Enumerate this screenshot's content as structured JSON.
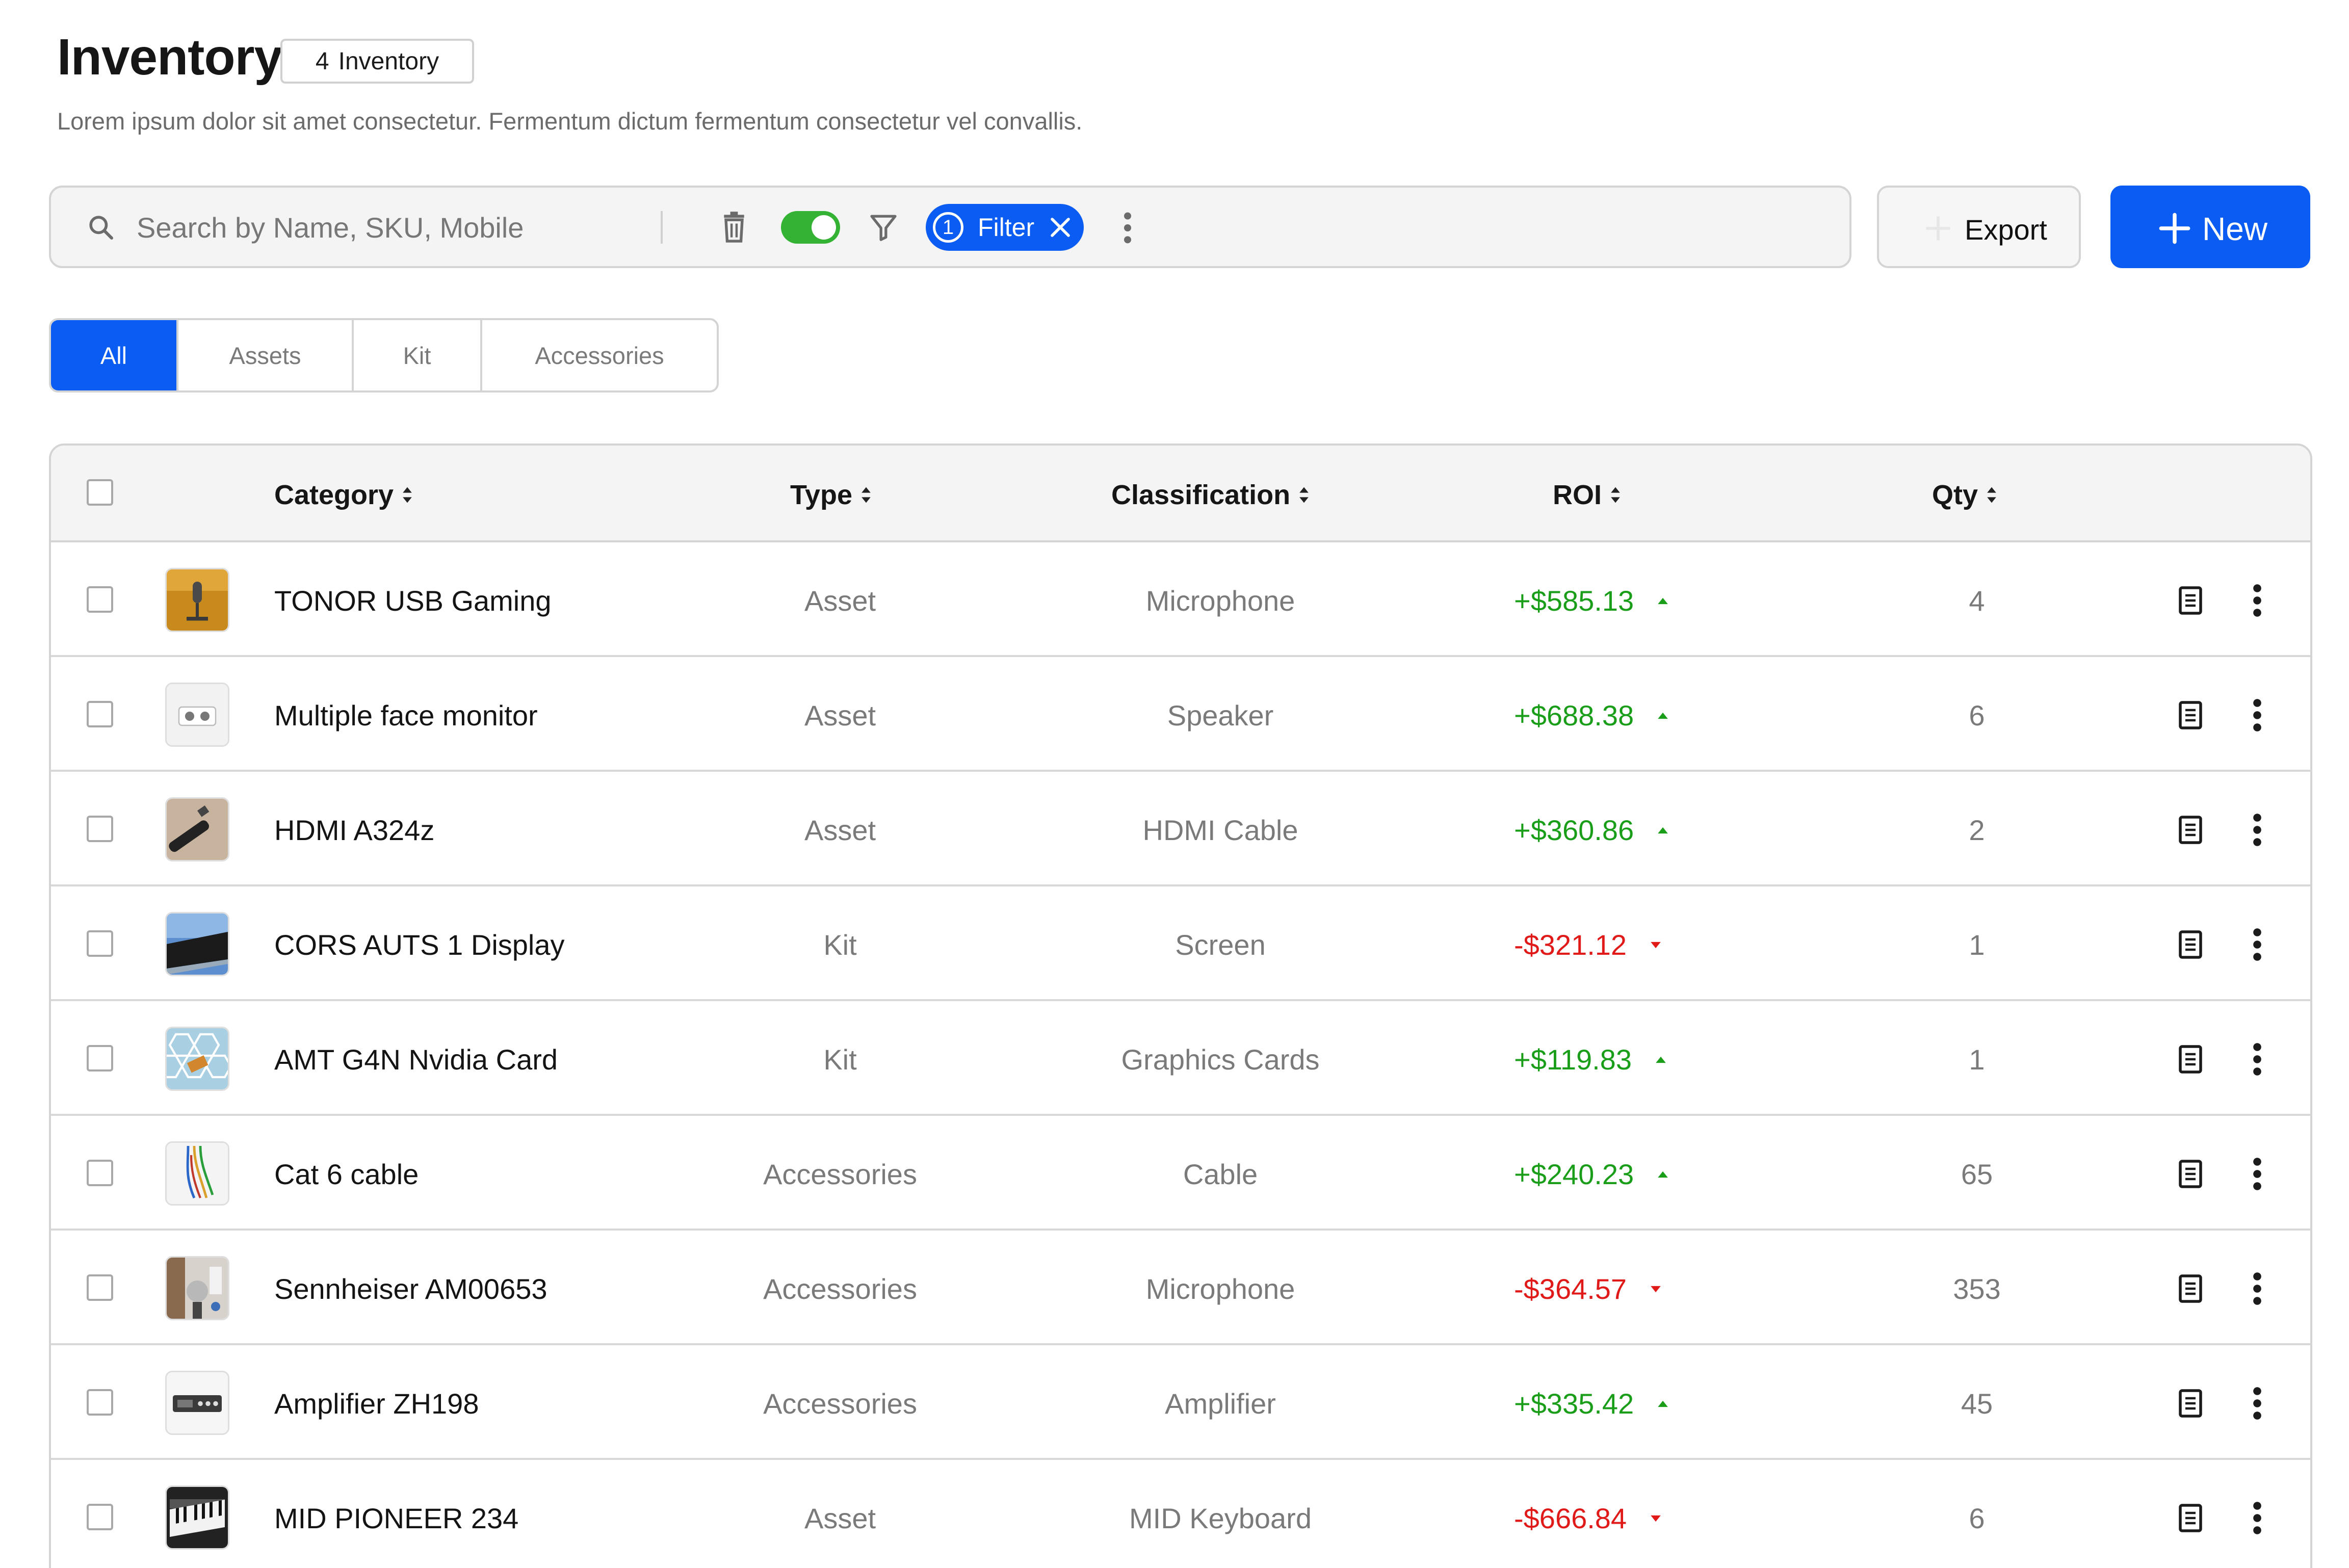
{
  "header": {
    "title": "Inventory",
    "badge": {
      "count": "4",
      "label": "Inventory"
    },
    "subtitle": "Lorem ipsum dolor sit amet consectetur. Fermentum dictum fermentum consectetur vel convallis."
  },
  "toolbar": {
    "search_placeholder": "Search by Name, SKU, Mobile",
    "toggle_on": true,
    "filter": {
      "count": "1",
      "label": "Filter"
    }
  },
  "actions": {
    "export_label": "Export",
    "new_label": "New"
  },
  "tabs": [
    {
      "label": "All",
      "active": true
    },
    {
      "label": "Assets",
      "active": false
    },
    {
      "label": "Kit",
      "active": false
    },
    {
      "label": "Accessories",
      "active": false
    }
  ],
  "table": {
    "headers": {
      "category": "Category",
      "type": "Type",
      "classification": "Classification",
      "roi": "ROI",
      "qty": "Qty"
    },
    "rows": [
      {
        "name": "TONOR USB Gaming",
        "type": "Asset",
        "classification": "Microphone",
        "roi": "+$585.13",
        "trend": "up",
        "qty": "4",
        "thumb": "microphone"
      },
      {
        "name": "Multiple face monitor",
        "type": "Asset",
        "classification": "Speaker",
        "roi": "+$688.38",
        "trend": "up",
        "qty": "6",
        "thumb": "speaker"
      },
      {
        "name": "HDMI A324z",
        "type": "Asset",
        "classification": "HDMI Cable",
        "roi": "+$360.86",
        "trend": "up",
        "qty": "2",
        "thumb": "hdmi-cable"
      },
      {
        "name": "CORS AUTS 1 Display",
        "type": "Kit",
        "classification": "Screen",
        "roi": "-$321.12",
        "trend": "down",
        "qty": "1",
        "thumb": "display"
      },
      {
        "name": "AMT G4N Nvidia Card",
        "type": "Kit",
        "classification": "Graphics Cards",
        "roi": "+$119.83",
        "trend": "up",
        "qty": "1",
        "thumb": "graphics-card"
      },
      {
        "name": "Cat 6 cable",
        "type": "Accessories",
        "classification": "Cable",
        "roi": "+$240.23",
        "trend": "up",
        "qty": "65",
        "thumb": "cat6-cable"
      },
      {
        "name": "Sennheiser AM00653",
        "type": "Accessories",
        "classification": "Microphone",
        "roi": "-$364.57",
        "trend": "down",
        "qty": "353",
        "thumb": "studio-mic"
      },
      {
        "name": "Amplifier ZH198",
        "type": "Accessories",
        "classification": "Amplifier",
        "roi": "+$335.42",
        "trend": "up",
        "qty": "45",
        "thumb": "amplifier"
      },
      {
        "name": "MID PIONEER 234",
        "type": "Asset",
        "classification": "MID Keyboard",
        "roi": "-$666.84",
        "trend": "down",
        "qty": "6",
        "thumb": "keyboard"
      }
    ]
  },
  "colors": {
    "accent": "#0b5cf2",
    "positive": "#1a9e1a",
    "negative": "#e01919",
    "toggle": "#34b233"
  }
}
